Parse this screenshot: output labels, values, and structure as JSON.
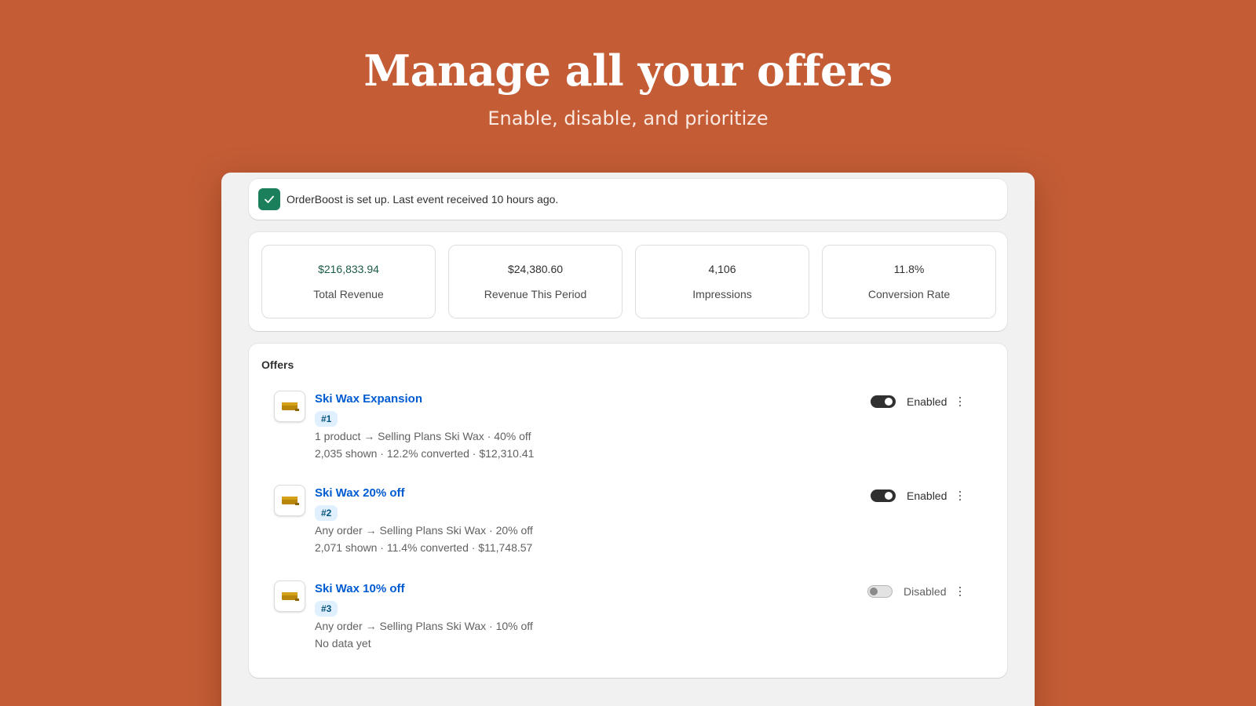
{
  "hero": {
    "title": "Manage all your offers",
    "subtitle": "Enable, disable, and prioritize"
  },
  "setup_banner": {
    "icon": "check-icon",
    "text": "OrderBoost is set up. Last event received 10 hours ago."
  },
  "stats": [
    {
      "value": "$216,833.94",
      "label": "Total Revenue",
      "color": "#1a5c43"
    },
    {
      "value": "$24,380.60",
      "label": "Revenue This Period"
    },
    {
      "value": "4,106",
      "label": "Impressions"
    },
    {
      "value": "11.8%",
      "label": "Conversion Rate"
    }
  ],
  "offers": {
    "heading": "Offers",
    "items": [
      {
        "title": "Ski Wax Expansion",
        "badge": "#1",
        "description": "1 product → Selling Plans Ski Wax · 40% off",
        "stats": "2,035 shown · 12.2% converted · $12,310.41",
        "status": "Enabled",
        "enabled": true
      },
      {
        "title": "Ski Wax 20% off",
        "badge": "#2",
        "description": "Any order → Selling Plans Ski Wax · 20% off",
        "stats": "2,071 shown · 11.4% converted · $11,748.57",
        "status": "Enabled",
        "enabled": true
      },
      {
        "title": "Ski Wax 10% off",
        "badge": "#3",
        "description": "Any order → Selling Plans Ski Wax · 10% off",
        "stats": "No data yet",
        "status": "Disabled",
        "enabled": false
      }
    ]
  },
  "colors": {
    "background": "#c45d36",
    "accent_link": "#005bd3",
    "success": "#1a7f5a"
  }
}
